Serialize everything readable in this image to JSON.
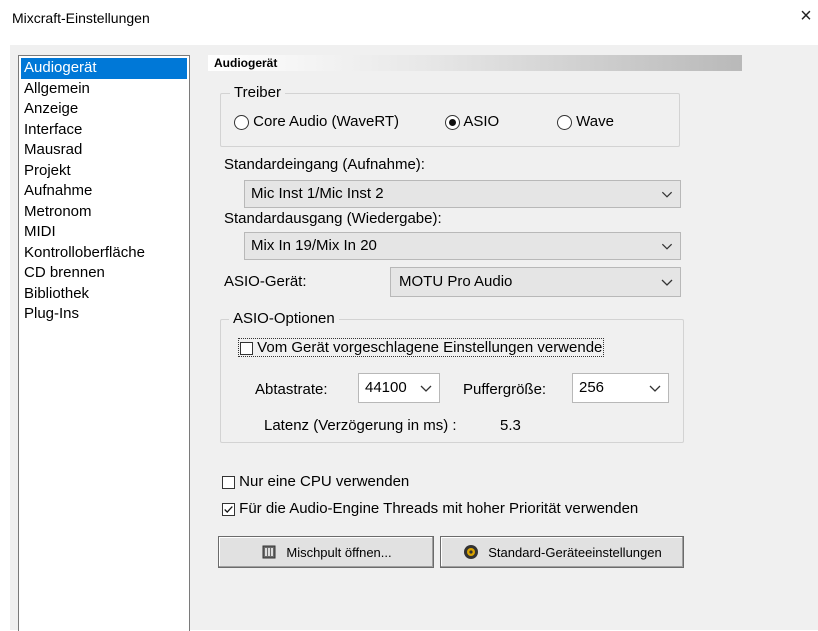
{
  "window": {
    "title": "Mixcraft-Einstellungen",
    "close_glyph": "×"
  },
  "sidebar": {
    "items": [
      {
        "label": "Audiogerät",
        "selected": true
      },
      {
        "label": "Allgemein"
      },
      {
        "label": "Anzeige"
      },
      {
        "label": "Interface"
      },
      {
        "label": "Mausrad"
      },
      {
        "label": "Projekt"
      },
      {
        "label": "Aufnahme"
      },
      {
        "label": "Metronom"
      },
      {
        "label": "MIDI"
      },
      {
        "label": "Kontrolloberfläche"
      },
      {
        "label": "CD brennen"
      },
      {
        "label": "Bibliothek"
      },
      {
        "label": "Plug-Ins"
      }
    ]
  },
  "panel": {
    "header": "Audiogerät",
    "driver": {
      "legend": "Treiber",
      "options": [
        {
          "label": "Core Audio (WaveRT)",
          "selected": false
        },
        {
          "label": "ASIO",
          "selected": true
        },
        {
          "label": "Wave",
          "selected": false
        }
      ]
    },
    "input": {
      "label": "Standardeingang (Aufnahme):",
      "value": "Mic Inst 1/Mic Inst 2"
    },
    "output": {
      "label": "Standardausgang (Wiedergabe):",
      "value": "Mix In 19/Mix In 20"
    },
    "asio_device": {
      "label": "ASIO-Gerät:",
      "value": "MOTU Pro Audio"
    },
    "asio_options": {
      "legend": "ASIO-Optionen",
      "use_device_settings": {
        "label": "Vom Gerät vorgeschlagene Einstellungen verwende",
        "checked": false
      },
      "sample_rate": {
        "label": "Abtastrate:",
        "value": "44100"
      },
      "buffer_size": {
        "label": "Puffergröße:",
        "value": "256"
      },
      "latency": {
        "label": "Latenz (Verzögerung in ms) :",
        "value": "5.3"
      }
    },
    "single_cpu": {
      "label": "Nur eine CPU verwenden",
      "checked": false
    },
    "high_priority": {
      "label": "Für die Audio-Engine Threads mit hoher Priorität verwenden",
      "checked": true
    },
    "buttons": {
      "mixer": "Mischpult öffnen...",
      "defaults": "Standard-Geräteeinstellungen"
    }
  },
  "colors": {
    "selection": "#0078d7",
    "panel_bg": "#f0f0f0"
  }
}
